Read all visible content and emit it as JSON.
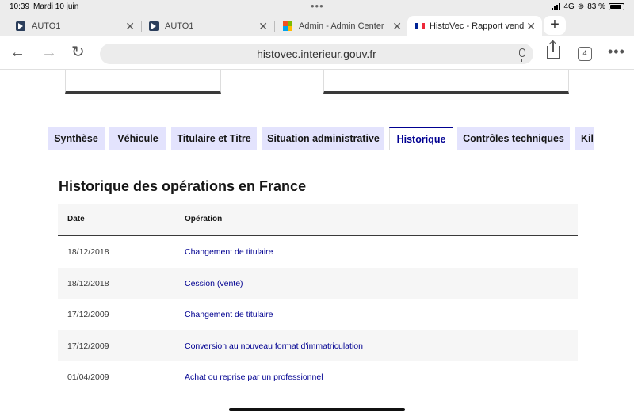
{
  "status": {
    "time": "10:39",
    "date": "Mardi 10 juin",
    "network": "4G",
    "battery": "83 %"
  },
  "tabs": [
    {
      "title": "AUTO1",
      "favicon": "auto1-icon"
    },
    {
      "title": "AUTO1",
      "favicon": "auto1-icon"
    },
    {
      "title": "Admin - Admin Center",
      "favicon": "admin-center-icon"
    },
    {
      "title": "HistoVec - Rapport vend",
      "favicon": "french-flag-icon"
    }
  ],
  "toolbar": {
    "url": "histovec.interieur.gouv.fr",
    "tab_count": "4"
  },
  "nav": {
    "tabs": [
      "Synthèse",
      "Véhicule",
      "Titulaire et Titre",
      "Situation administrative",
      "Historique",
      "Contrôles techniques",
      "Kilo"
    ],
    "active": "Historique"
  },
  "section": {
    "title": "Historique des opérations en France",
    "columns": {
      "date": "Date",
      "operation": "Opération"
    },
    "rows": [
      {
        "date": "18/12/2018",
        "operation": "Changement de titulaire"
      },
      {
        "date": "18/12/2018",
        "operation": "Cession (vente)"
      },
      {
        "date": "17/12/2009",
        "operation": "Changement de titulaire"
      },
      {
        "date": "17/12/2009",
        "operation": "Conversion au nouveau format d'immatriculation"
      },
      {
        "date": "01/04/2009",
        "operation": "Achat ou reprise par un professionnel"
      }
    ]
  },
  "colors": {
    "accent": "#000091",
    "tab_bg": "#e3e3fd",
    "row_alt": "#f6f6f6"
  }
}
